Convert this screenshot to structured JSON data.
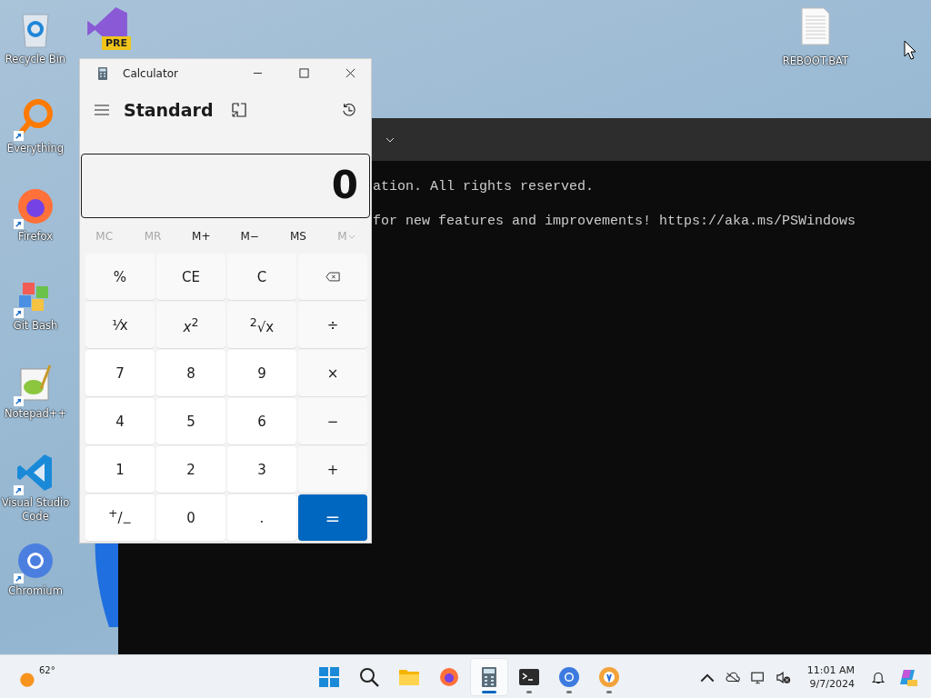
{
  "desktop_icons": [
    {
      "label": "Recycle Bin",
      "kind": "recycle",
      "shortcut": false
    },
    {
      "label": "Everything",
      "kind": "everything",
      "shortcut": true
    },
    {
      "label": "Firefox",
      "kind": "firefox",
      "shortcut": true
    },
    {
      "label": "Git Bash",
      "kind": "git",
      "shortcut": true
    },
    {
      "label": "Notepad++",
      "kind": "notepad",
      "shortcut": true
    },
    {
      "label": "Visual Studio Code",
      "kind": "vscode",
      "shortcut": true
    },
    {
      "label": "Chromium",
      "kind": "chromium",
      "shortcut": true
    }
  ],
  "preview_icon": {
    "badge": "PRE"
  },
  "file_icon": {
    "label": "REBOOT.BAT"
  },
  "terminal": {
    "lines": [
      "ation. All rights reserved.",
      "for new features and improvements! https://aka.ms/PSWindows"
    ]
  },
  "calculator": {
    "title": "Calculator",
    "mode": "Standard",
    "display": "0",
    "memory": [
      {
        "label": "MC",
        "disabled": true,
        "kind": "plain"
      },
      {
        "label": "MR",
        "disabled": true,
        "kind": "plain"
      },
      {
        "label": "M+",
        "disabled": false,
        "kind": "plain"
      },
      {
        "label": "M−",
        "disabled": false,
        "kind": "plain"
      },
      {
        "label": "MS",
        "disabled": false,
        "kind": "plain"
      },
      {
        "label": "M",
        "disabled": true,
        "kind": "dropdown"
      }
    ],
    "keys": [
      {
        "label": "%",
        "kind": "func"
      },
      {
        "label": "CE",
        "kind": "func"
      },
      {
        "label": "C",
        "kind": "func"
      },
      {
        "kind": "backspace"
      },
      {
        "label": "¹⁄x",
        "kind": "func"
      },
      {
        "label": "*x*$^{2}$",
        "kind": "func"
      },
      {
        "label": "$^{2}$√x",
        "kind": "func"
      },
      {
        "label": "÷",
        "kind": "func"
      },
      {
        "label": "7",
        "kind": "digit"
      },
      {
        "label": "8",
        "kind": "digit"
      },
      {
        "label": "9",
        "kind": "digit"
      },
      {
        "label": "×",
        "kind": "func"
      },
      {
        "label": "4",
        "kind": "digit"
      },
      {
        "label": "5",
        "kind": "digit"
      },
      {
        "label": "6",
        "kind": "digit"
      },
      {
        "label": "−",
        "kind": "func"
      },
      {
        "label": "1",
        "kind": "digit"
      },
      {
        "label": "2",
        "kind": "digit"
      },
      {
        "label": "3",
        "kind": "digit"
      },
      {
        "label": "+",
        "kind": "func"
      },
      {
        "label": "$^{+}$/$_{−}$",
        "kind": "digit"
      },
      {
        "label": "0",
        "kind": "digit"
      },
      {
        "label": ".",
        "kind": "digit"
      },
      {
        "label": "=",
        "kind": "equals"
      }
    ]
  },
  "taskbar": {
    "weather": "62°",
    "apps": [
      {
        "kind": "start",
        "selected": false,
        "running": false
      },
      {
        "kind": "search",
        "selected": false,
        "running": false
      },
      {
        "kind": "explorer",
        "selected": false,
        "running": false
      },
      {
        "kind": "firefox",
        "selected": false,
        "running": false
      },
      {
        "kind": "calculator",
        "selected": true,
        "running": true
      },
      {
        "kind": "terminal",
        "selected": false,
        "running": true
      },
      {
        "kind": "chromium",
        "selected": false,
        "running": true
      },
      {
        "kind": "browser",
        "selected": false,
        "running": true
      }
    ],
    "time": "11:01 AM",
    "date": "9/7/2024"
  }
}
